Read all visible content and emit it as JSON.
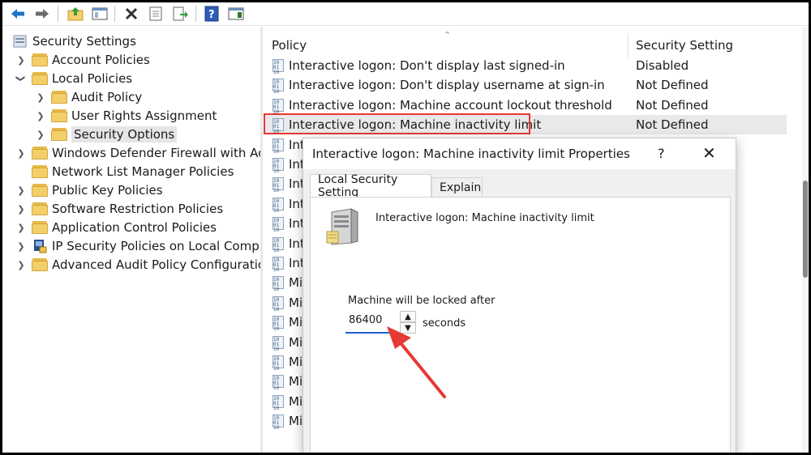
{
  "toolbar": {
    "icons": [
      "back-arrow-icon",
      "forward-arrow-icon",
      "up-folder-icon",
      "show-hide-tree-icon",
      "delete-icon",
      "properties-icon",
      "export-list-icon",
      "help-icon",
      "show-hide-action-pane-icon"
    ]
  },
  "tree": {
    "root": "Security Settings",
    "items": [
      {
        "label": "Account Policies"
      },
      {
        "label": "Local Policies"
      },
      {
        "label": "Audit Policy"
      },
      {
        "label": "User Rights Assignment"
      },
      {
        "label": "Security Options"
      },
      {
        "label": "Windows Defender Firewall with Advan"
      },
      {
        "label": "Network List Manager Policies"
      },
      {
        "label": "Public Key Policies"
      },
      {
        "label": "Software Restriction Policies"
      },
      {
        "label": "Application Control Policies"
      },
      {
        "label": "IP Security Policies on Local Computer"
      },
      {
        "label": "Advanced Audit Policy Configuration"
      }
    ]
  },
  "list": {
    "col_policy": "Policy",
    "col_setting": "Security Setting",
    "rows": [
      {
        "policy": "Interactive logon: Don't display last signed-in",
        "setting": "Disabled"
      },
      {
        "policy": "Interactive logon: Don't display username at sign-in",
        "setting": "Not Defined"
      },
      {
        "policy": "Interactive logon: Machine account lockout threshold",
        "setting": "Not Defined"
      },
      {
        "policy": "Interactive logon: Machine inactivity limit",
        "setting": "Not Defined"
      },
      {
        "policy": "Int",
        "setting": ""
      },
      {
        "policy": "Int",
        "setting": ""
      },
      {
        "policy": "Int",
        "setting": ""
      },
      {
        "policy": "Int",
        "setting": ""
      },
      {
        "policy": "Int",
        "setting": ""
      },
      {
        "policy": "Int",
        "setting": ""
      },
      {
        "policy": "Int",
        "setting": ""
      },
      {
        "policy": "Mi",
        "setting": ""
      },
      {
        "policy": "Mi",
        "setting": ""
      },
      {
        "policy": "Mi",
        "setting": ""
      },
      {
        "policy": "Mi",
        "setting": ""
      },
      {
        "policy": "Mi",
        "setting": ""
      },
      {
        "policy": "Mi",
        "setting": ""
      },
      {
        "policy": "Mi",
        "setting": ""
      },
      {
        "policy": "Mi",
        "setting": ""
      }
    ]
  },
  "dialog": {
    "title": "Interactive logon: Machine inactivity limit Properties",
    "help": "?",
    "close": "✕",
    "tab_local": "Local Security Setting",
    "tab_explain": "Explain",
    "policy_name": "Interactive logon: Machine inactivity limit",
    "lock_label": "Machine will be locked after",
    "value": "86400",
    "unit": "seconds"
  },
  "colors": {
    "highlight_box": "#e53935",
    "annotation_arrow": "#e53935",
    "input_underline": "#1c5fc9"
  }
}
